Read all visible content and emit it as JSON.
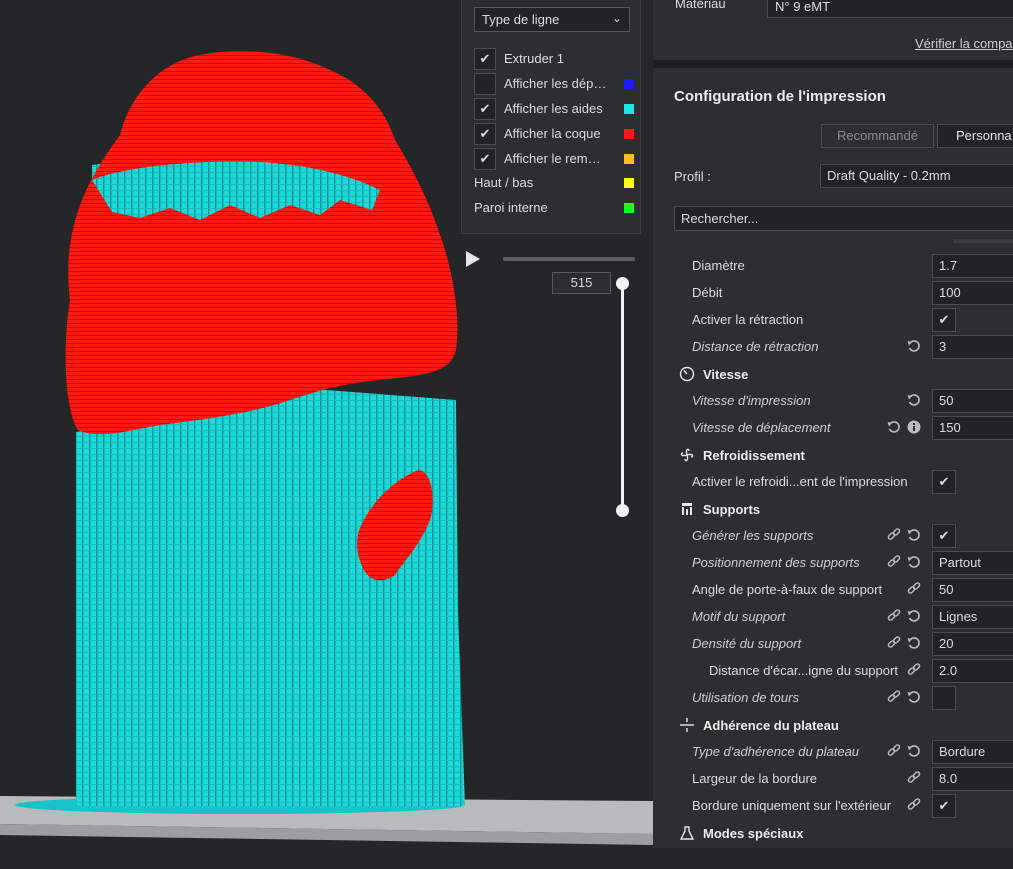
{
  "layer_view": {
    "type_select": "Type de ligne",
    "legend": [
      {
        "label": "Extruder 1",
        "checked": true,
        "color": null
      },
      {
        "label": "Afficher les dép…",
        "checked": false,
        "color": "#1a1aff"
      },
      {
        "label": "Afficher les aides",
        "checked": true,
        "color": "#19e6e6"
      },
      {
        "label": "Afficher la coque",
        "checked": true,
        "color": "#ff1a1a"
      },
      {
        "label": "Afficher le rem…",
        "checked": true,
        "color": "#ffbf1a"
      },
      {
        "label": "Haut / bas",
        "checked": null,
        "color": "#ffff1a"
      },
      {
        "label": "Paroi interne",
        "checked": null,
        "color": "#1aff1a"
      }
    ],
    "layer_number": "515"
  },
  "material": {
    "label": "Matériau",
    "value": "N° 9 eMT",
    "verify_link": "Vérifier la compa"
  },
  "print_setup": {
    "title": "Configuration de l'impression",
    "mode_recommended": "Recommandé",
    "mode_custom": "Personna",
    "profile_label": "Profil :",
    "profile_value": "Draft Quality - 0.2mm",
    "search_placeholder": "Rechercher..."
  },
  "settings": [
    {
      "type": "row",
      "label": "Diamètre",
      "value": "1.7"
    },
    {
      "type": "row",
      "label": "Débit",
      "value": "100"
    },
    {
      "type": "row",
      "label": "Activer la rétraction",
      "check": true
    },
    {
      "type": "row",
      "label": "Distance de rétraction",
      "value": "3",
      "italic": true,
      "reset": true
    },
    {
      "type": "head",
      "label": "Vitesse",
      "icon": "speedometer-icon"
    },
    {
      "type": "row",
      "label": "Vitesse d'impression",
      "value": "50",
      "italic": true,
      "reset": true
    },
    {
      "type": "row",
      "label": "Vitesse de déplacement",
      "value": "150",
      "italic": true,
      "reset": true,
      "info": true
    },
    {
      "type": "head",
      "label": "Refroidissement",
      "icon": "fan-icon"
    },
    {
      "type": "row",
      "label": "Activer le refroidi...ent de l'impression",
      "check": true
    },
    {
      "type": "head",
      "label": "Supports",
      "icon": "support-icon"
    },
    {
      "type": "row",
      "label": "Générer les supports",
      "check": true,
      "italic": true,
      "link": true,
      "reset": true
    },
    {
      "type": "row",
      "label": "Positionnement des supports",
      "value": "Partout",
      "italic": true,
      "link": true,
      "reset": true
    },
    {
      "type": "row",
      "label": "Angle de porte-à-faux de support",
      "value": "50",
      "link": true
    },
    {
      "type": "row",
      "label": "Motif du support",
      "value": "Lignes",
      "italic": true,
      "link": true,
      "reset": true
    },
    {
      "type": "row",
      "label": "Densité du support",
      "value": "20",
      "italic": true,
      "link": true,
      "reset": true
    },
    {
      "type": "row",
      "label": "Distance d'écar...igne du support",
      "value": "2.0",
      "link": true,
      "indent": true
    },
    {
      "type": "row",
      "label": "Utilisation de tours",
      "check": false,
      "italic": true,
      "link": true,
      "reset": true
    },
    {
      "type": "head",
      "label": "Adhérence du plateau",
      "icon": "adhesion-icon"
    },
    {
      "type": "row",
      "label": "Type d'adhérence du plateau",
      "value": "Bordure",
      "italic": true,
      "link": true,
      "reset": true
    },
    {
      "type": "row",
      "label": "Largeur de la bordure",
      "value": "8.0",
      "link": true
    },
    {
      "type": "row",
      "label": "Bordure uniquement sur l'extérieur",
      "check": true,
      "link": true
    },
    {
      "type": "head",
      "label": "Modes spéciaux",
      "icon": "flask-icon"
    }
  ],
  "colors": {
    "shell": "#ff1a1a",
    "support": "#19e6e6",
    "build_plate": "#c8c8c8"
  }
}
